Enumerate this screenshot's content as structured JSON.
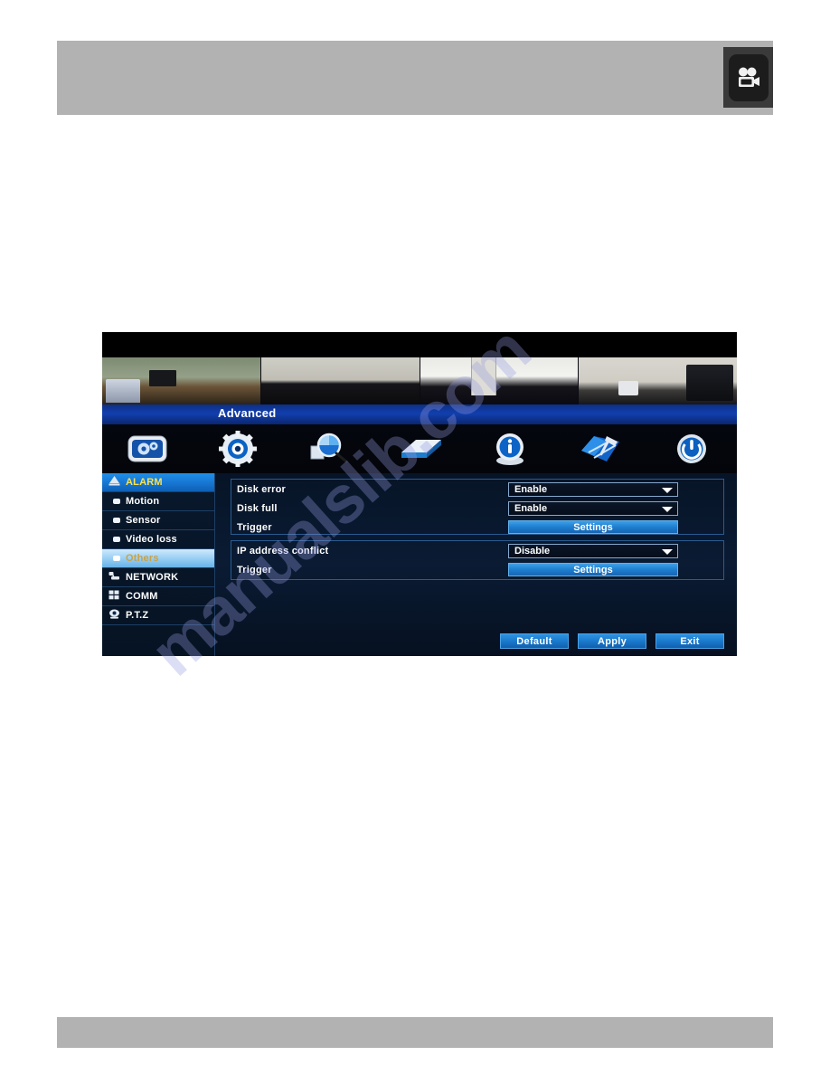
{
  "page": {
    "watermark": "manualslib.com",
    "background_color": "#ffffff",
    "header_bar_color": "#b2b2b2",
    "footer_bar_color": "#b2b2b2"
  },
  "header": {
    "icon": "movie-camera-icon",
    "icon_button_color": "#1c1c1c"
  },
  "dvr": {
    "title": "Advanced",
    "cameras": [
      {
        "label": "camera-1"
      },
      {
        "label": "camera-2"
      },
      {
        "label": "camera-3"
      },
      {
        "label": "camera-4"
      }
    ],
    "toolbar": [
      {
        "icon": "display-settings-icon"
      },
      {
        "icon": "record-gear-icon"
      },
      {
        "icon": "search-magnifier-icon"
      },
      {
        "icon": "hard-disk-icon"
      },
      {
        "icon": "information-icon"
      },
      {
        "icon": "tools-icon"
      },
      {
        "icon": "power-icon"
      }
    ],
    "sidebar": [
      {
        "label": "ALARM",
        "type": "group",
        "icon": "alarm-icon",
        "selected": false
      },
      {
        "label": "Motion",
        "type": "sub",
        "icon": "bullet-icon",
        "selected": false
      },
      {
        "label": "Sensor",
        "type": "sub",
        "icon": "bullet-icon",
        "selected": false
      },
      {
        "label": "Video loss",
        "type": "sub",
        "icon": "bullet-icon",
        "selected": false
      },
      {
        "label": "Others",
        "type": "sub",
        "icon": "bullet-icon",
        "selected": true
      },
      {
        "label": "NETWORK",
        "type": "category",
        "icon": "network-icon",
        "selected": false
      },
      {
        "label": "COMM",
        "type": "category",
        "icon": "comm-icon",
        "selected": false
      },
      {
        "label": "P.T.Z",
        "type": "category",
        "icon": "ptz-icon",
        "selected": false
      }
    ],
    "panels": [
      {
        "name": "disk-panel",
        "rows": [
          {
            "label": "Disk error",
            "control": "dropdown",
            "value": "Enable"
          },
          {
            "label": "Disk full",
            "control": "dropdown",
            "value": "Enable"
          },
          {
            "label": "Trigger",
            "control": "button",
            "value": "Settings"
          }
        ]
      },
      {
        "name": "ip-panel",
        "rows": [
          {
            "label": "IP address conflict",
            "control": "dropdown",
            "value": "Disable"
          },
          {
            "label": "Trigger",
            "control": "button",
            "value": "Settings"
          }
        ]
      }
    ],
    "dropdown_options": [
      "Enable",
      "Disable"
    ],
    "bottom_buttons": [
      {
        "label": "Default"
      },
      {
        "label": "Apply"
      },
      {
        "label": "Exit"
      }
    ],
    "colors": {
      "accent_blue": "#1a79cc",
      "title_bar_blue": "#123fae",
      "group_text_yellow": "#ffe24a",
      "selected_row": "#9fd2f5"
    }
  }
}
